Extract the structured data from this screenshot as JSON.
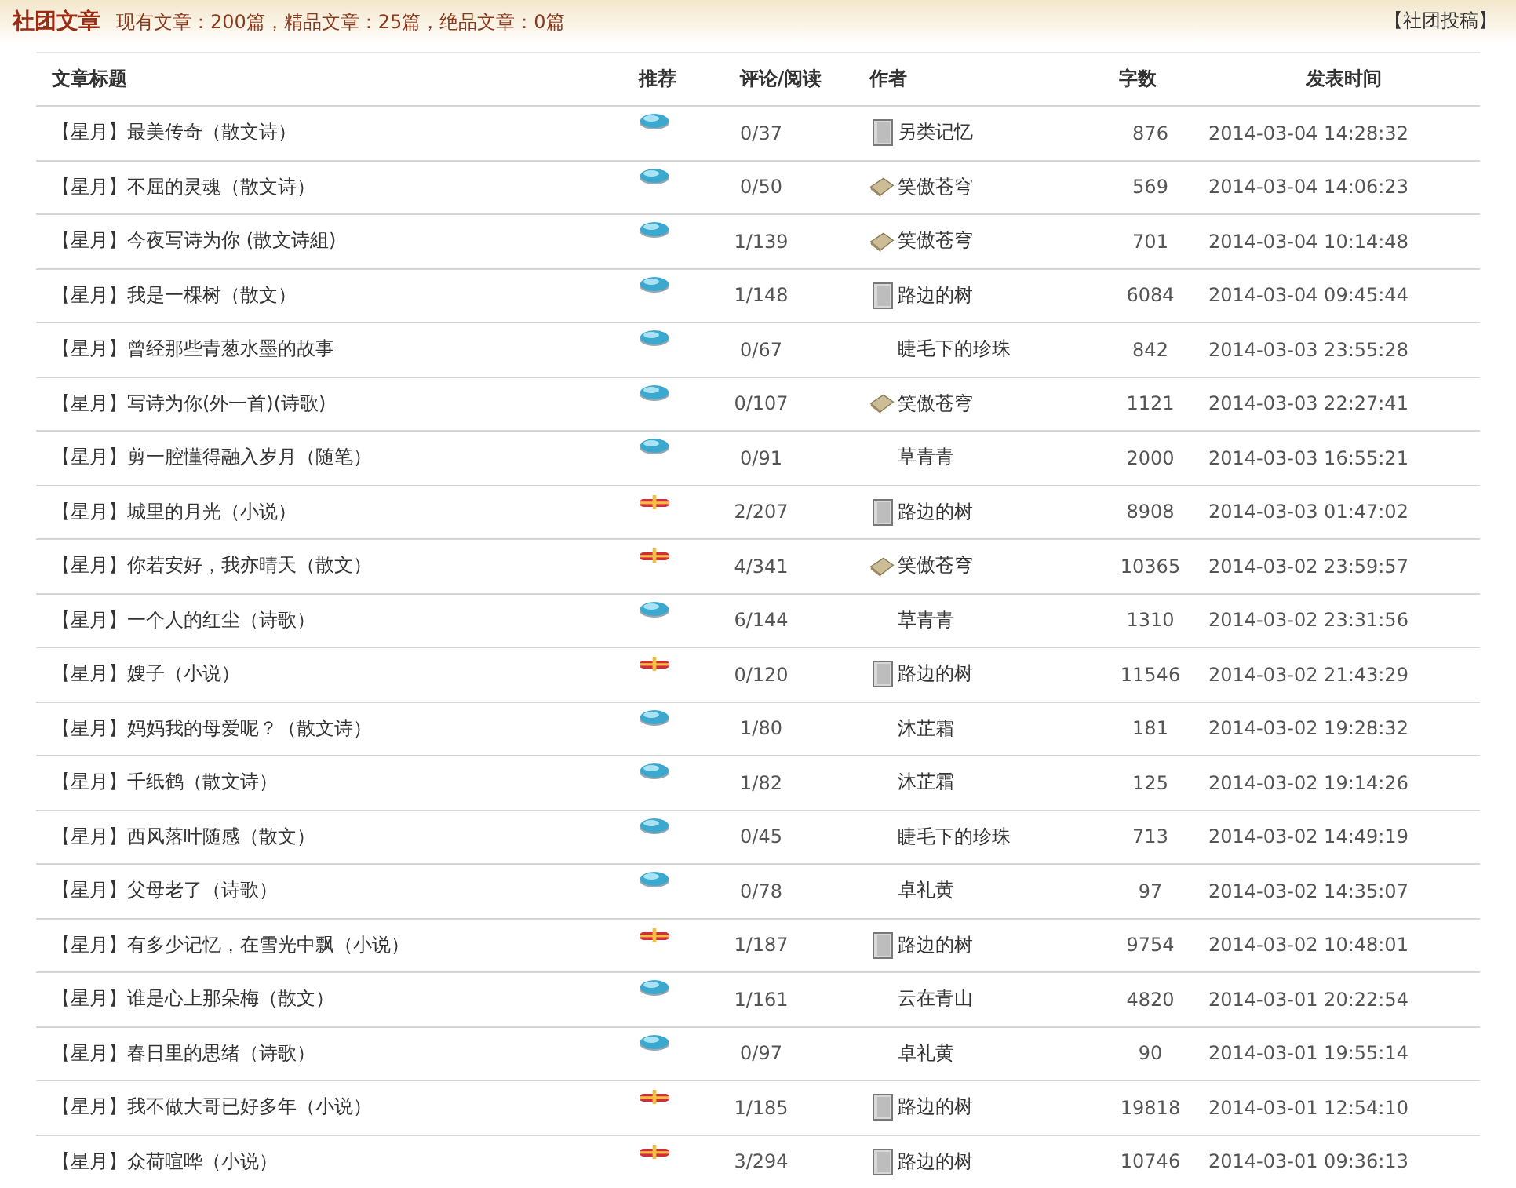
{
  "header": {
    "title": "社团文章",
    "stats": "现有文章：200篇，精品文章：25篇，绝品文章：0篇",
    "submit_link": "【社团投稿】"
  },
  "table": {
    "columns": [
      "文章标题",
      "推荐",
      "评论/阅读",
      "作者",
      "字数",
      "发表时间"
    ],
    "rows": [
      {
        "title": "【星月】最美传奇（散文诗）",
        "recommend": {
          "kind": "gem"
        },
        "comments": "0/37",
        "author_icon": {
          "kind": "page"
        },
        "author": "另类记忆",
        "words": "876",
        "time": "2014-03-04 14:28:32"
      },
      {
        "title": "【星月】不屈的灵魂（散文诗）",
        "recommend": {
          "kind": "gem"
        },
        "comments": "0/50",
        "author_icon": {
          "kind": "parcel"
        },
        "author": "笑傲苍穹",
        "words": "569",
        "time": "2014-03-04 14:06:23"
      },
      {
        "title": "【星月】今夜写诗为你 (散文诗組)",
        "recommend": {
          "kind": "gem"
        },
        "comments": "1/139",
        "author_icon": {
          "kind": "parcel"
        },
        "author": "笑傲苍穹",
        "words": "701",
        "time": "2014-03-04 10:14:48"
      },
      {
        "title": "【星月】我是一棵树（散文）",
        "recommend": {
          "kind": "gem"
        },
        "comments": "1/148",
        "author_icon": {
          "kind": "page"
        },
        "author": "路边的树",
        "words": "6084",
        "time": "2014-03-04 09:45:44"
      },
      {
        "title": "【星月】曾经那些青葱水墨的故事",
        "recommend": {
          "kind": "gem"
        },
        "comments": "0/67",
        "author": "睫毛下的珍珠",
        "words": "842",
        "time": "2014-03-03 23:55:28"
      },
      {
        "title": "【星月】写诗为你(外一首)(诗歌)",
        "recommend": {
          "kind": "gem"
        },
        "comments": "0/107",
        "author_icon": {
          "kind": "parcel"
        },
        "author": "笑傲苍穹",
        "words": "1121",
        "time": "2014-03-03 22:27:41"
      },
      {
        "title": "【星月】剪一腔懂得融入岁月（随笔）",
        "recommend": {
          "kind": "gem"
        },
        "comments": "0/91",
        "author": "草青青",
        "words": "2000",
        "time": "2014-03-03 16:55:21"
      },
      {
        "title": "【星月】城里的月光（小说）",
        "recommend": {
          "kind": "ribbon"
        },
        "comments": "2/207",
        "author_icon": {
          "kind": "page"
        },
        "author": "路边的树",
        "words": "8908",
        "time": "2014-03-03 01:47:02"
      },
      {
        "title": "【星月】你若安好，我亦晴天（散文）",
        "recommend": {
          "kind": "ribbon"
        },
        "comments": "4/341",
        "author_icon": {
          "kind": "parcel"
        },
        "author": "笑傲苍穹",
        "words": "10365",
        "time": "2014-03-02 23:59:57"
      },
      {
        "title": "【星月】一个人的红尘（诗歌）",
        "recommend": {
          "kind": "gem"
        },
        "comments": "6/144",
        "author": "草青青",
        "words": "1310",
        "time": "2014-03-02 23:31:56"
      },
      {
        "title": "【星月】嫂子（小说）",
        "recommend": {
          "kind": "ribbon"
        },
        "comments": "0/120",
        "author_icon": {
          "kind": "page"
        },
        "author": "路边的树",
        "words": "11546",
        "time": "2014-03-02 21:43:29"
      },
      {
        "title": "【星月】妈妈我的母爱呢？（散文诗）",
        "recommend": {
          "kind": "gem"
        },
        "comments": "1/80",
        "author": "沐芷霜",
        "words": "181",
        "time": "2014-03-02 19:28:32"
      },
      {
        "title": "【星月】千纸鹤（散文诗）",
        "recommend": {
          "kind": "gem"
        },
        "comments": "1/82",
        "author": "沐芷霜",
        "words": "125",
        "time": "2014-03-02 19:14:26"
      },
      {
        "title": "【星月】西风落叶随感（散文）",
        "recommend": {
          "kind": "gem"
        },
        "comments": "0/45",
        "author": "睫毛下的珍珠",
        "words": "713",
        "time": "2014-03-02 14:49:19"
      },
      {
        "title": "【星月】父母老了（诗歌）",
        "recommend": {
          "kind": "gem"
        },
        "comments": "0/78",
        "author": "卓礼黄",
        "words": "97",
        "time": "2014-03-02 14:35:07"
      },
      {
        "title": "【星月】有多少记忆，在雪光中飘（小说）",
        "recommend": {
          "kind": "ribbon"
        },
        "comments": "1/187",
        "author_icon": {
          "kind": "page"
        },
        "author": "路边的树",
        "words": "9754",
        "time": "2014-03-02 10:48:01"
      },
      {
        "title": "【星月】谁是心上那朵梅（散文）",
        "recommend": {
          "kind": "gem"
        },
        "comments": "1/161",
        "author": "云在青山",
        "words": "4820",
        "time": "2014-03-01 20:22:54"
      },
      {
        "title": "【星月】春日里的思绪（诗歌）",
        "recommend": {
          "kind": "gem"
        },
        "comments": "0/97",
        "author": "卓礼黄",
        "words": "90",
        "time": "2014-03-01 19:55:14"
      },
      {
        "title": "【星月】我不做大哥已好多年（小说）",
        "recommend": {
          "kind": "ribbon"
        },
        "comments": "1/185",
        "author_icon": {
          "kind": "page"
        },
        "author": "路边的树",
        "words": "19818",
        "time": "2014-03-01 12:54:10"
      },
      {
        "title": "【星月】众荷喧哗（小说）",
        "recommend": {
          "kind": "ribbon"
        },
        "comments": "3/294",
        "author_icon": {
          "kind": "page"
        },
        "author": "路边的树",
        "words": "10746",
        "time": "2014-03-01 09:36:13"
      }
    ]
  }
}
